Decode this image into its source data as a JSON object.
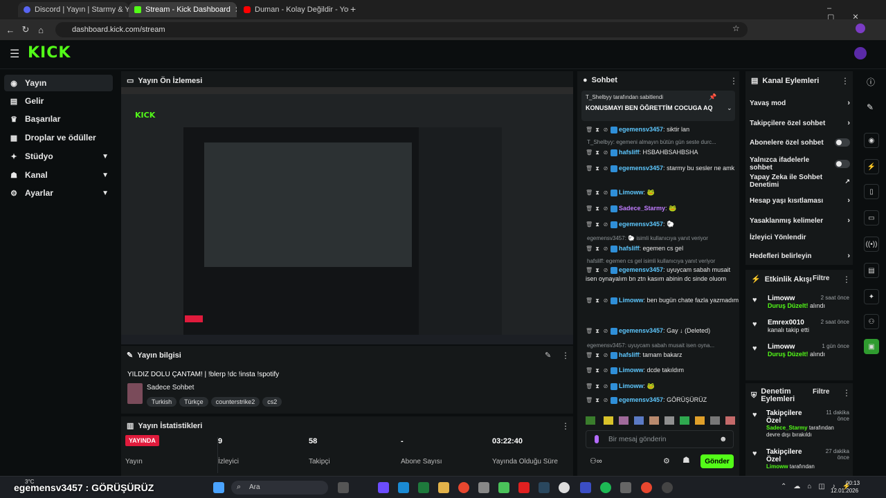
{
  "browser": {
    "tabs": [
      {
        "label": "Discord | Yayın | Starmy & Y",
        "active": false
      },
      {
        "label": "Stream - Kick Dashboard",
        "active": true
      },
      {
        "label": "Duman - Kolay Değildir - YouTube",
        "active": false
      }
    ],
    "url": "dashboard.kick.com/stream"
  },
  "app": {
    "logo": "KICK"
  },
  "sidebar": {
    "items": [
      {
        "label": "Yayın",
        "icon": "broadcast-icon",
        "active": true
      },
      {
        "label": "Gelir",
        "icon": "revenue-icon"
      },
      {
        "label": "Başarılar",
        "icon": "trophy-icon"
      },
      {
        "label": "Droplar ve ödüller",
        "icon": "gift-icon"
      },
      {
        "label": "Stüdyo",
        "icon": "studio-icon",
        "expandable": true
      },
      {
        "label": "Kanal",
        "icon": "channel-icon",
        "expandable": true
      },
      {
        "label": "Ayarlar",
        "icon": "settings-icon",
        "expandable": true
      }
    ]
  },
  "preview": {
    "title": "Yayın Ön İzlemesi"
  },
  "stream_info": {
    "title": "Yayın bilgisi",
    "stream_title": "YILDIZ DOLU ÇANTAM! | !blerp !dc !insta !spotify",
    "category": "Sadece Sohbet",
    "tags": [
      "Turkish",
      "Türkçe",
      "counterstrike2",
      "cs2"
    ]
  },
  "stats": {
    "title": "Yayın İstatistikleri",
    "status": "YAYINDA",
    "status_label": "Yayın",
    "viewers": "9",
    "viewers_label": "İzleyici",
    "followers": "58",
    "followers_label": "Takipçi",
    "subs": "-",
    "subs_label": "Abone Sayısı",
    "uptime": "03:22:40",
    "uptime_label": "Yayında Olduğu Süre"
  },
  "chat": {
    "title": "Sohbet",
    "pinned_by": "T_Shelbyy tarafından sabitlendi",
    "pinned_text": "KONUSMAYI BEN ÖĞRETTİM COCUGA AQ",
    "messages": [
      {
        "user": "egemensv3457",
        "text": "siktir lan",
        "color": "#5ec8ff"
      },
      {
        "reply": "T_Shelbyy: egemeni almayın bütün gün seste durc..."
      },
      {
        "user": "hafsliff",
        "text": "HSBAHBSAHBSHA",
        "color": "#5ec8ff"
      },
      {
        "user": "egemensv3457",
        "text": "starmy bu sesler ne amk",
        "color": "#5ec8ff"
      },
      {
        "user": "Limoww",
        "text": "🐸",
        "color": "#5ec8ff"
      },
      {
        "user": "Sadece_Starmy",
        "text": "🐸",
        "color": "#c07cff"
      },
      {
        "user": "egemensv3457",
        "text": "🐑",
        "color": "#5ec8ff"
      },
      {
        "reply": "egemensv3457: 🐑 isimli kullanıcıya yanıt veriyor"
      },
      {
        "user": "hafsliff",
        "text": "egemen cs gel",
        "color": "#5ec8ff"
      },
      {
        "reply": "hafsliff: egemen cs gel isimli kullanıcıya yanıt veriyor"
      },
      {
        "user": "egemensv3457",
        "text": "uyuycam sabah musait isen oynayalım bn ztn kasım abinin dc sinde oluom",
        "color": "#5ec8ff"
      },
      {
        "user": "Limoww",
        "text": "ben bugün chate fazla yazmadım",
        "color": "#5ec8ff"
      },
      {
        "user": "egemensv3457",
        "text": "Gay ↓ (Deleted)",
        "color": "#5ec8ff"
      },
      {
        "reply": "egemensv3457: uyuycam sabah musait isen oyna..."
      },
      {
        "user": "hafsliff",
        "text": "tamam bakarz",
        "color": "#5ec8ff"
      },
      {
        "user": "Limoww",
        "text": "dcde takıldım",
        "color": "#5ec8ff"
      },
      {
        "user": "Limoww",
        "text": "🐸",
        "color": "#5ec8ff"
      },
      {
        "user": "egemensv3457",
        "text": "GÖRÜŞÜRÜZ",
        "color": "#5ec8ff"
      }
    ],
    "input_placeholder": "Bir mesaj gönderin",
    "send_label": "Gönder"
  },
  "channel_actions": {
    "title": "Kanal Eylemleri",
    "items": [
      {
        "label": "Yavaş mod",
        "control": "chevron"
      },
      {
        "label": "Takipçilere özel sohbet",
        "control": "chevron"
      },
      {
        "label": "Abonelere özel sohbet",
        "control": "toggle"
      },
      {
        "label": "Yalnızca ifadelerle sohbet",
        "control": "toggle"
      },
      {
        "label": "Yapay Zeka ile Sohbet Denetimi",
        "control": "external"
      },
      {
        "label": "Hesap yaşı kısıtlaması",
        "control": "chevron"
      },
      {
        "label": "Yasaklanmış kelimeler",
        "control": "chevron"
      },
      {
        "label": "İzleyici Yönlendir",
        "control": "none"
      },
      {
        "label": "Hedefleri belirleyin",
        "control": "chevron"
      }
    ]
  },
  "activity": {
    "title": "Etkinlik Akışı",
    "filter": "Filtre",
    "events": [
      {
        "name": "Limoww",
        "line1": "Duruş Düzelt!",
        "line2": " alındı",
        "time": "2 saat önce"
      },
      {
        "name": "Emrex0010",
        "line1": "",
        "line2": "kanalı takip etti",
        "time": "2 saat önce"
      },
      {
        "name": "Limoww",
        "line1": "Duruş Düzelt!",
        "line2": " alındı",
        "time": "1 gün önce"
      }
    ]
  },
  "moderation": {
    "title": "Denetim Eylemleri",
    "filter": "Filtre",
    "events": [
      {
        "name": "Takipçilere Özel",
        "by": "Sadece_Starmy",
        "rest": " tarafından devre dışı bırakıldı",
        "time": "11 dakika önce"
      },
      {
        "name": "Takipçilere Özel",
        "by": "Limoww",
        "rest": " tarafından",
        "time": "27 dakika önce"
      }
    ]
  },
  "taskbar": {
    "weather": "3°C",
    "search": "Ara",
    "time": "00:13",
    "date": "12.01.2026"
  },
  "overlay_text": "egemensv3457 : GÖRÜŞÜRÜZ"
}
